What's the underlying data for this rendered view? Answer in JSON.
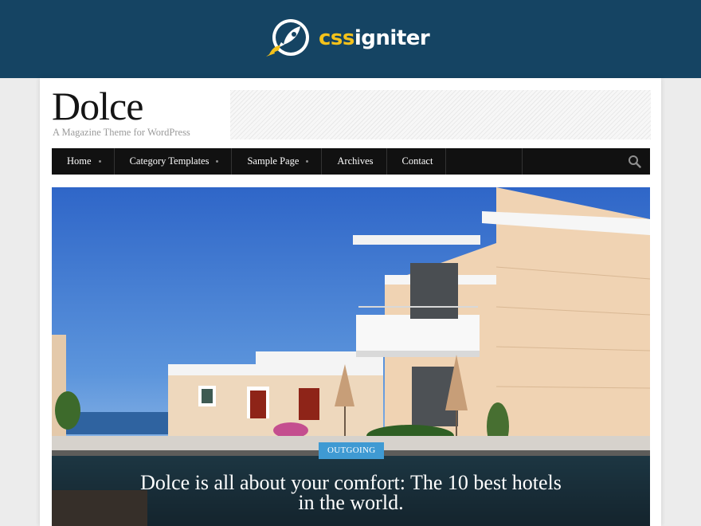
{
  "brand": {
    "part1": "css",
    "part2": "igniter",
    "colors": {
      "bar": "#154463",
      "accent": "#f4c21b"
    }
  },
  "site": {
    "title": "Dolce",
    "tagline": "A Magazine Theme for WordPress"
  },
  "nav": {
    "items": [
      {
        "label": "Home",
        "has_dropdown": true
      },
      {
        "label": "Category Templates",
        "has_dropdown": true
      },
      {
        "label": "Sample Page",
        "has_dropdown": true
      },
      {
        "label": "Archives",
        "has_dropdown": false
      },
      {
        "label": "Contact",
        "has_dropdown": false
      }
    ],
    "search_icon": "search-icon"
  },
  "hero": {
    "category": "OUTGOING",
    "title": "Dolce is all about your comfort: The 10 best hotels in the world.",
    "image": "resort-villa-with-pool-photo"
  }
}
